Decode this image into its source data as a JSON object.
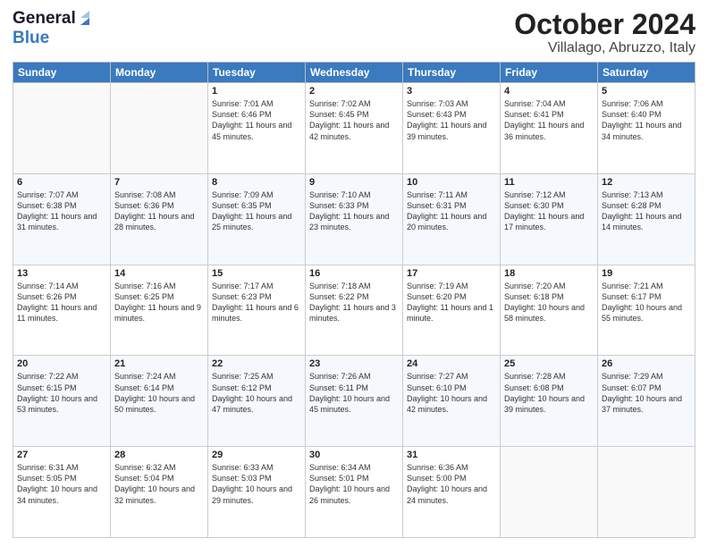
{
  "header": {
    "logo_general": "General",
    "logo_blue": "Blue",
    "month_title": "October 2024",
    "location": "Villalago, Abruzzo, Italy"
  },
  "days_of_week": [
    "Sunday",
    "Monday",
    "Tuesday",
    "Wednesday",
    "Thursday",
    "Friday",
    "Saturday"
  ],
  "weeks": [
    {
      "days": [
        {
          "num": "",
          "detail": ""
        },
        {
          "num": "",
          "detail": ""
        },
        {
          "num": "1",
          "detail": "Sunrise: 7:01 AM\nSunset: 6:46 PM\nDaylight: 11 hours and 45 minutes."
        },
        {
          "num": "2",
          "detail": "Sunrise: 7:02 AM\nSunset: 6:45 PM\nDaylight: 11 hours and 42 minutes."
        },
        {
          "num": "3",
          "detail": "Sunrise: 7:03 AM\nSunset: 6:43 PM\nDaylight: 11 hours and 39 minutes."
        },
        {
          "num": "4",
          "detail": "Sunrise: 7:04 AM\nSunset: 6:41 PM\nDaylight: 11 hours and 36 minutes."
        },
        {
          "num": "5",
          "detail": "Sunrise: 7:06 AM\nSunset: 6:40 PM\nDaylight: 11 hours and 34 minutes."
        }
      ]
    },
    {
      "days": [
        {
          "num": "6",
          "detail": "Sunrise: 7:07 AM\nSunset: 6:38 PM\nDaylight: 11 hours and 31 minutes."
        },
        {
          "num": "7",
          "detail": "Sunrise: 7:08 AM\nSunset: 6:36 PM\nDaylight: 11 hours and 28 minutes."
        },
        {
          "num": "8",
          "detail": "Sunrise: 7:09 AM\nSunset: 6:35 PM\nDaylight: 11 hours and 25 minutes."
        },
        {
          "num": "9",
          "detail": "Sunrise: 7:10 AM\nSunset: 6:33 PM\nDaylight: 11 hours and 23 minutes."
        },
        {
          "num": "10",
          "detail": "Sunrise: 7:11 AM\nSunset: 6:31 PM\nDaylight: 11 hours and 20 minutes."
        },
        {
          "num": "11",
          "detail": "Sunrise: 7:12 AM\nSunset: 6:30 PM\nDaylight: 11 hours and 17 minutes."
        },
        {
          "num": "12",
          "detail": "Sunrise: 7:13 AM\nSunset: 6:28 PM\nDaylight: 11 hours and 14 minutes."
        }
      ]
    },
    {
      "days": [
        {
          "num": "13",
          "detail": "Sunrise: 7:14 AM\nSunset: 6:26 PM\nDaylight: 11 hours and 11 minutes."
        },
        {
          "num": "14",
          "detail": "Sunrise: 7:16 AM\nSunset: 6:25 PM\nDaylight: 11 hours and 9 minutes."
        },
        {
          "num": "15",
          "detail": "Sunrise: 7:17 AM\nSunset: 6:23 PM\nDaylight: 11 hours and 6 minutes."
        },
        {
          "num": "16",
          "detail": "Sunrise: 7:18 AM\nSunset: 6:22 PM\nDaylight: 11 hours and 3 minutes."
        },
        {
          "num": "17",
          "detail": "Sunrise: 7:19 AM\nSunset: 6:20 PM\nDaylight: 11 hours and 1 minute."
        },
        {
          "num": "18",
          "detail": "Sunrise: 7:20 AM\nSunset: 6:18 PM\nDaylight: 10 hours and 58 minutes."
        },
        {
          "num": "19",
          "detail": "Sunrise: 7:21 AM\nSunset: 6:17 PM\nDaylight: 10 hours and 55 minutes."
        }
      ]
    },
    {
      "days": [
        {
          "num": "20",
          "detail": "Sunrise: 7:22 AM\nSunset: 6:15 PM\nDaylight: 10 hours and 53 minutes."
        },
        {
          "num": "21",
          "detail": "Sunrise: 7:24 AM\nSunset: 6:14 PM\nDaylight: 10 hours and 50 minutes."
        },
        {
          "num": "22",
          "detail": "Sunrise: 7:25 AM\nSunset: 6:12 PM\nDaylight: 10 hours and 47 minutes."
        },
        {
          "num": "23",
          "detail": "Sunrise: 7:26 AM\nSunset: 6:11 PM\nDaylight: 10 hours and 45 minutes."
        },
        {
          "num": "24",
          "detail": "Sunrise: 7:27 AM\nSunset: 6:10 PM\nDaylight: 10 hours and 42 minutes."
        },
        {
          "num": "25",
          "detail": "Sunrise: 7:28 AM\nSunset: 6:08 PM\nDaylight: 10 hours and 39 minutes."
        },
        {
          "num": "26",
          "detail": "Sunrise: 7:29 AM\nSunset: 6:07 PM\nDaylight: 10 hours and 37 minutes."
        }
      ]
    },
    {
      "days": [
        {
          "num": "27",
          "detail": "Sunrise: 6:31 AM\nSunset: 5:05 PM\nDaylight: 10 hours and 34 minutes."
        },
        {
          "num": "28",
          "detail": "Sunrise: 6:32 AM\nSunset: 5:04 PM\nDaylight: 10 hours and 32 minutes."
        },
        {
          "num": "29",
          "detail": "Sunrise: 6:33 AM\nSunset: 5:03 PM\nDaylight: 10 hours and 29 minutes."
        },
        {
          "num": "30",
          "detail": "Sunrise: 6:34 AM\nSunset: 5:01 PM\nDaylight: 10 hours and 26 minutes."
        },
        {
          "num": "31",
          "detail": "Sunrise: 6:36 AM\nSunset: 5:00 PM\nDaylight: 10 hours and 24 minutes."
        },
        {
          "num": "",
          "detail": ""
        },
        {
          "num": "",
          "detail": ""
        }
      ]
    }
  ]
}
